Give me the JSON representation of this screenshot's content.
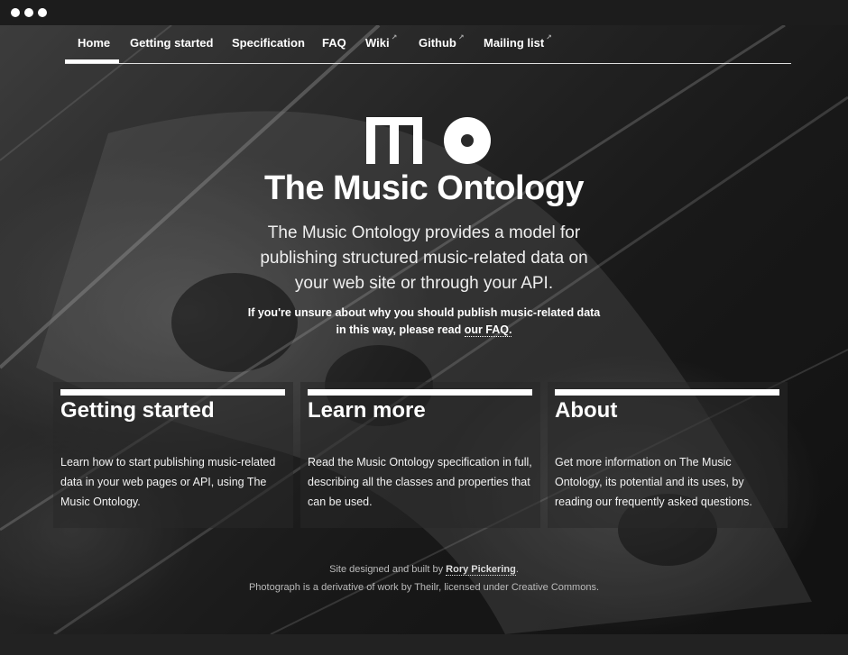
{
  "nav": {
    "items": [
      {
        "label": "Home",
        "external": false
      },
      {
        "label": "Getting started",
        "external": false
      },
      {
        "label": "Specification",
        "external": false
      },
      {
        "label": "FAQ",
        "external": false
      },
      {
        "label": "Wiki",
        "external": true
      },
      {
        "label": "Github",
        "external": true
      },
      {
        "label": "Mailing list",
        "external": true
      }
    ],
    "active": "Home",
    "external_icon": "↗"
  },
  "hero": {
    "logo_icon": "mo-logo-icon",
    "title": "The Music Ontology",
    "lead": "The Music Ontology provides a model for publishing structured music-related data on your web site or through your API.",
    "note_text": "If you're unsure about why you should publish music-related data in this way, please read ",
    "note_link": "our FAQ."
  },
  "cards": [
    {
      "title": "Getting started",
      "body": "Learn how to start publishing music-related data in your web pages or API, using The Music Ontology."
    },
    {
      "title": "Learn more",
      "body": "Read the Music Ontology specification in full, describing all the classes and properties that can be used."
    },
    {
      "title": "About",
      "body": "Get more information on The Music Ontology, its potential and its uses, by reading our frequently asked questions."
    }
  ],
  "footer": {
    "line1_prefix": "Site designed and built by ",
    "author": "Rory Pickering",
    "line1_suffix": ".",
    "line2": "Photograph is a derivative of work by Theilr, licensed under Creative Commons."
  },
  "colors": {
    "text": "#ffffff",
    "background": "#1a1a1a",
    "card_background": "rgba(40,40,40,0.55)"
  }
}
